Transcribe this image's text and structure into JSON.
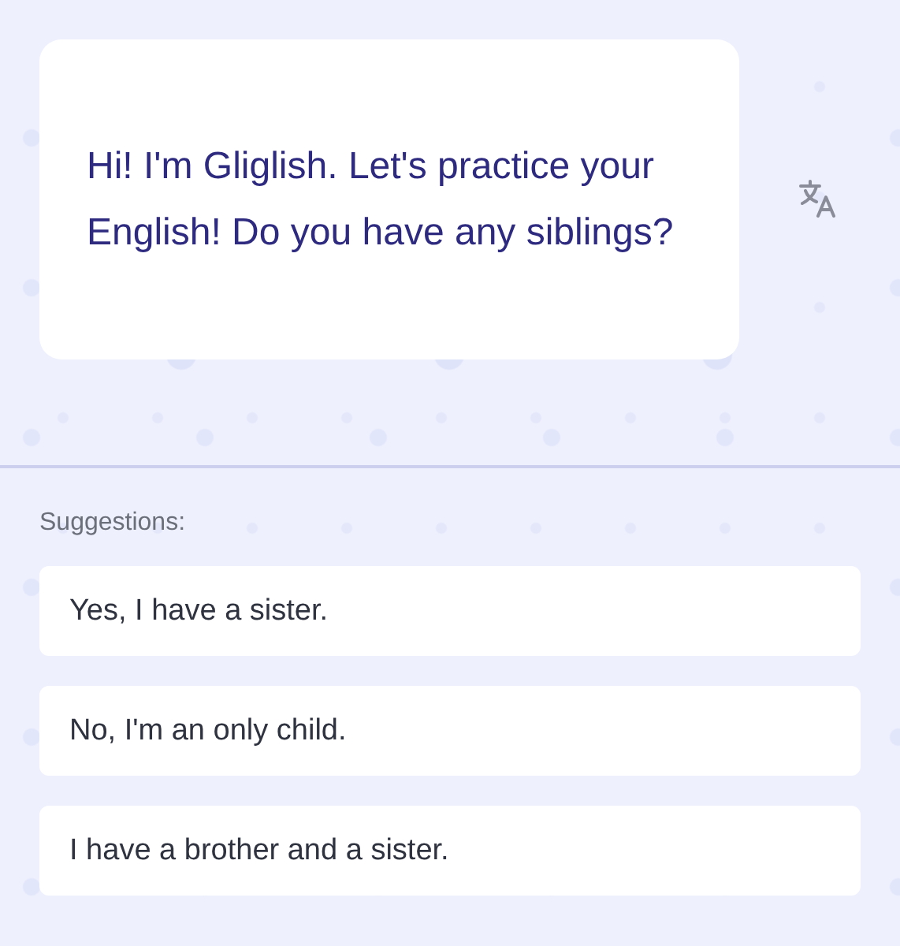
{
  "message": {
    "text": "Hi! I'm Gliglish. Let's practice your English! Do you have any siblings?"
  },
  "suggestions": {
    "label": "Suggestions:",
    "items": [
      "Yes, I have a sister.",
      "No, I'm an only child.",
      "I have a brother and a sister."
    ]
  }
}
